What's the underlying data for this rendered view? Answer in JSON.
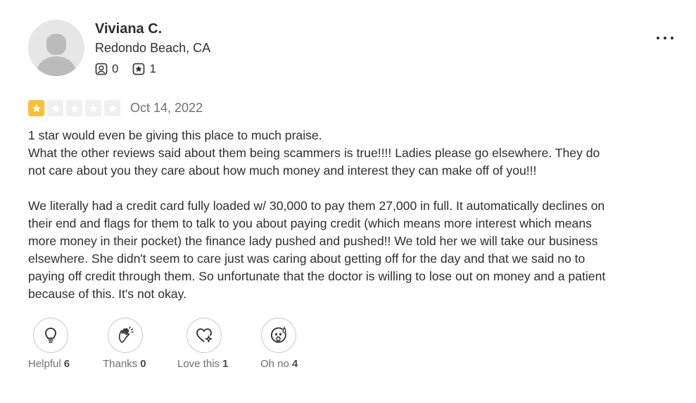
{
  "user": {
    "name": "Viviana C.",
    "location": "Redondo Beach, CA",
    "friends_count": "0",
    "reviews_count": "1"
  },
  "review": {
    "rating": 1,
    "max_rating": 5,
    "date": "Oct 14, 2022",
    "paragraph1": "1 star would even be giving this place to much praise.\nWhat the other reviews said about them being scammers is true!!!! Ladies please go elsewhere. They do not care about you they care about how much money and interest they can make off of you!!!",
    "paragraph2": "We literally had a credit card fully loaded w/ 30,000 to pay them 27,000 in full. It automatically declines on their end and flags for them to talk to you about paying credit (which means more interest which means more money in their pocket) the finance lady pushed and pushed!! We told her we will take our business elsewhere. She didn't seem to care just was caring about getting off for the day and that we said no to paying off credit through them. So unfortunate that the doctor is willing to lose out on money and a patient because of this. It's not okay."
  },
  "reactions": [
    {
      "label": "Helpful",
      "count": "6",
      "icon": "lightbulb-icon"
    },
    {
      "label": "Thanks",
      "count": "0",
      "icon": "clapping-hands-icon"
    },
    {
      "label": "Love this",
      "count": "1",
      "icon": "heart-sparkle-icon"
    },
    {
      "label": "Oh no",
      "count": "4",
      "icon": "shocked-face-icon"
    }
  ],
  "colors": {
    "star_filled": "#fac035",
    "star_empty": "#f0f0f1",
    "text": "#2d2e2f",
    "muted": "#6e7072"
  }
}
